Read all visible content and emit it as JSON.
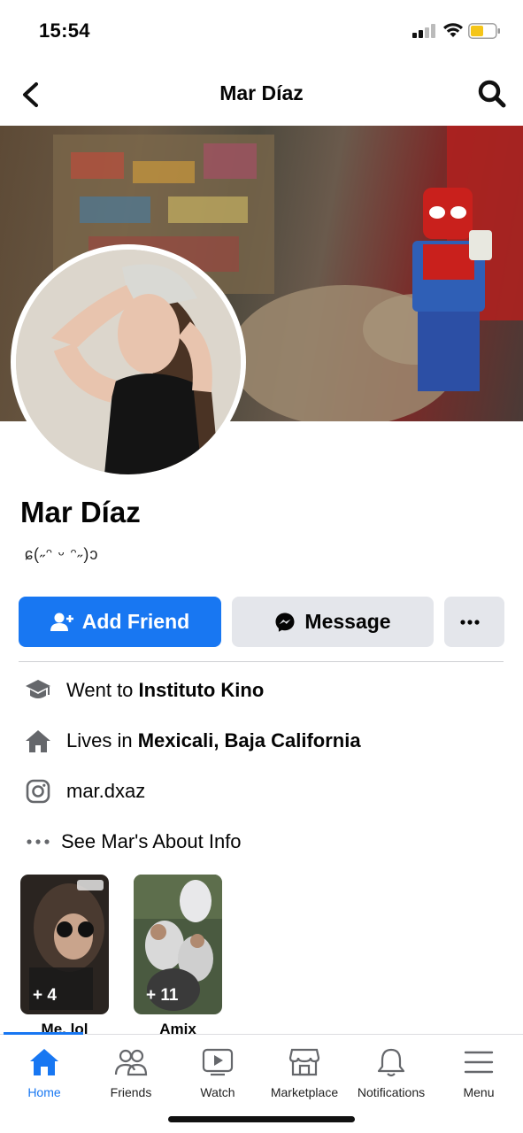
{
  "status_bar": {
    "time": "15:54"
  },
  "nav": {
    "title": "Mar Díaz"
  },
  "profile": {
    "name": "Mar Díaz",
    "bio": "ɕ(˶ᵔ ᵕ ᵔ˶)ɔ"
  },
  "actions": {
    "add_friend": "Add Friend",
    "message": "Message"
  },
  "info": {
    "education_prefix": "Went to ",
    "education_value": "Instituto Kino",
    "location_prefix": "Lives in ",
    "location_value": "Mexicali, Baja California",
    "instagram": "mar.dxaz",
    "about_link": "See Mar's About Info"
  },
  "highlights": [
    {
      "label": "Me. lol",
      "count": "+ 4"
    },
    {
      "label": "Amix",
      "count": "+ 11"
    }
  ],
  "tabs": [
    {
      "label": "Home",
      "icon": "home-icon",
      "active": true
    },
    {
      "label": "Friends",
      "icon": "friends-icon"
    },
    {
      "label": "Watch",
      "icon": "watch-icon"
    },
    {
      "label": "Marketplace",
      "icon": "marketplace-icon"
    },
    {
      "label": "Notifications",
      "icon": "bell-icon"
    },
    {
      "label": "Menu",
      "icon": "menu-icon"
    }
  ],
  "colors": {
    "accent": "#1877f2",
    "button_grey": "#e4e6eb",
    "battery": "#f5c518"
  }
}
